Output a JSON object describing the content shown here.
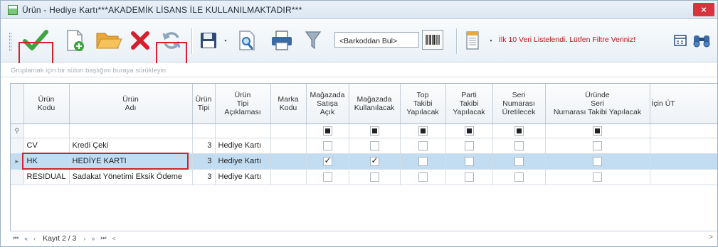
{
  "window": {
    "title": "Ürün - Hediye Kartı***AKADEMİK LİSANS İLE KULLANILMAKTADIR***",
    "close_label": "×"
  },
  "toolbar": {
    "barcode_placeholder": "<Barkoddan Bul>",
    "warning_text": "İlk 10 Veri Listelendi. Lütfen Filtre Veriniz!",
    "icons": [
      "check-icon",
      "new-document-icon",
      "open-folder-icon",
      "delete-icon",
      "refresh-icon",
      "save-icon",
      "dropdown-arrow-icon",
      "preview-icon",
      "print-icon",
      "filter-icon",
      "barcode-icon",
      "report-icon",
      "dropdown-arrow-icon",
      "calculator-icon",
      "binoculars-icon"
    ],
    "colors": {
      "check": "#3fa43f",
      "delete": "#d4202c",
      "highlight_box": "#d4202c",
      "warning": "#d0121c"
    }
  },
  "group_panel": {
    "hint": "Gruplamak için bir sütun başlığını buraya sürükleyin"
  },
  "grid": {
    "columns": [
      {
        "key": "code",
        "label": "Ürün\nKodu"
      },
      {
        "key": "name",
        "label": "Ürün\nAdı"
      },
      {
        "key": "type",
        "label": "Ürün\nTipi"
      },
      {
        "key": "type_desc",
        "label": "Ürün\nTipi\nAçıklaması"
      },
      {
        "key": "brand",
        "label": "Marka\nKodu"
      },
      {
        "key": "store_sale",
        "label": "Mağazada\nSatışa\nAçık"
      },
      {
        "key": "store_use",
        "label": "Mağazada\nKullanılacak"
      },
      {
        "key": "lot",
        "label": "Top\nTakibi\nYapılacak"
      },
      {
        "key": "batch",
        "label": "Parti\nTakibi\nYapılacak"
      },
      {
        "key": "serial",
        "label": "Seri\nNumarası\nÜretilecek"
      },
      {
        "key": "serial_track",
        "label": "Üründe\nSeri\nNumarası Takibi Yapılacak"
      },
      {
        "key": "for",
        "label": "İçin ÜT"
      }
    ],
    "rows": [
      {
        "code": "CV",
        "name": "Kredi Çeki",
        "type": "3",
        "type_desc": "Hediye Kartı",
        "checks": [
          false,
          false,
          false,
          false,
          false,
          false
        ]
      },
      {
        "code": "HK",
        "name": "HEDİYE KARTI",
        "type": "3",
        "type_desc": "Hediye Kartı",
        "checks": [
          true,
          true,
          false,
          false,
          false,
          false
        ],
        "selected": true
      },
      {
        "code": "RESIDUAL",
        "name": "Sadakat Yönetimi Eksik Ödeme",
        "type": "3",
        "type_desc": "Hediye Kartı",
        "checks": [
          false,
          false,
          false,
          false,
          false,
          false
        ]
      }
    ]
  },
  "navigator": {
    "record_text": "Kayıt 2 / 3",
    "first": "⏮",
    "prev_page": "«",
    "prev": "‹",
    "next": "›",
    "next_page": "»",
    "last": "⏭",
    "more": "<",
    "scroll_right": ">"
  }
}
